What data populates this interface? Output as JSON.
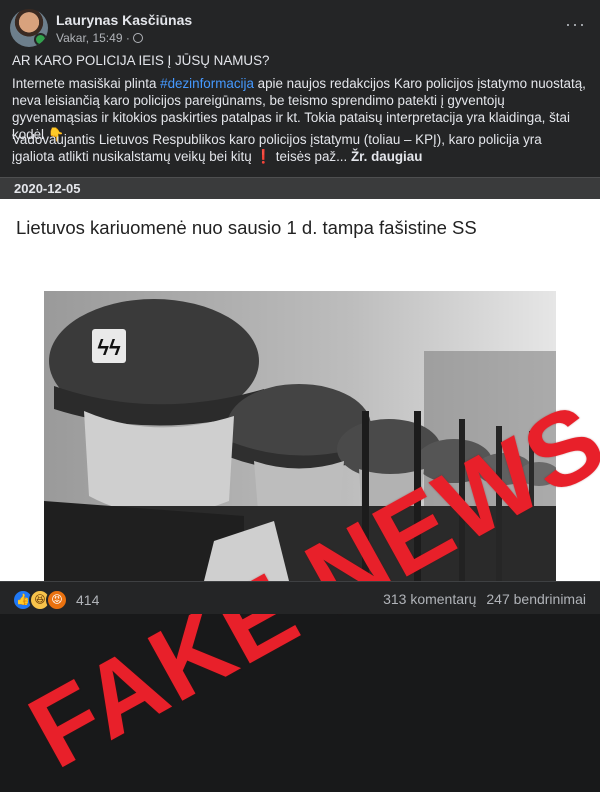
{
  "post": {
    "author": "Laurynas Kasčiūnas",
    "time": "Vakar, 15:49 ·",
    "headline": "AR KARO POLICIJA IEIS Į JŪSŲ NAMUS?",
    "para1_before": "Internete masiškai plinta ",
    "hashtag": "#dezinformacija",
    "para1_after": " apie naujos redakcijos Karo policijos įstatymo nuostatą, neva leisiančią karo policijos pareigūnams, be teismo sprendimo patekti į gyventojų gyvenamąsias ir kitokios paskirties patalpas ir kt. Tokia pataisų interpretacija yra klaidinga, štai kodėl",
    "para1_emoji": "👇",
    "para2_before": "Vadovaujantis Lietuvos Respublikos karo policijos įstatymu (toliau – KPĮ), karo policija yra įgaliota atlikti nusikalstamų veikų bei kitų ",
    "para2_emoji": "❗",
    "para2_after": " teisės paž... ",
    "see_more": "Žr. daugiau"
  },
  "shared": {
    "date": "2020-12-05",
    "title": "Lietuvos kariuomenė nuo sausio 1 d. tampa fašistine SS",
    "stamp": "FAKE NEWS"
  },
  "footer": {
    "reaction_count": "414",
    "comments": "313 komentarų",
    "shares": "247 bendrinimai"
  },
  "colors": {
    "background": "#242526",
    "hashtag": "#4599ff",
    "stamp_red": "#e8202a"
  }
}
